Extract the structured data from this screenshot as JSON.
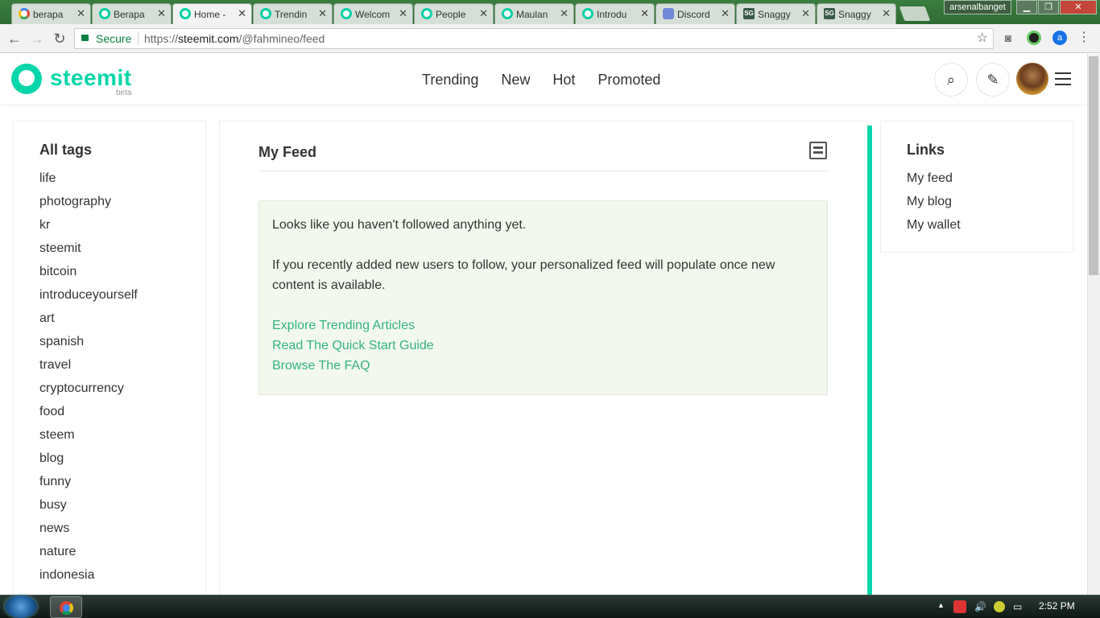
{
  "browser": {
    "tabs": [
      {
        "label": "berapa",
        "favicon": "google-icon"
      },
      {
        "label": "Berapa",
        "favicon": "steemit-icon"
      },
      {
        "label": "Home -",
        "favicon": "steemit-icon",
        "active": true
      },
      {
        "label": "Trendin",
        "favicon": "steemit-icon"
      },
      {
        "label": "Welcom",
        "favicon": "steemit-icon"
      },
      {
        "label": "People",
        "favicon": "steemit-icon"
      },
      {
        "label": "Maulan",
        "favicon": "steemit-icon"
      },
      {
        "label": "Introdu",
        "favicon": "steemit-icon"
      },
      {
        "label": "Discord",
        "favicon": "discord-icon"
      },
      {
        "label": "Snaggy",
        "favicon": "snaggy-icon"
      },
      {
        "label": "Snaggy",
        "favicon": "snaggy-icon"
      }
    ],
    "window_user": "arsenalbanget",
    "secure_label": "Secure",
    "url_scheme": "https://",
    "url_host": "steemit.com",
    "url_path": "/@fahmineo/feed",
    "snaggy_favicon_text": "SG"
  },
  "site": {
    "logo_text": "steemit",
    "logo_badge": "beta",
    "nav": [
      "Trending",
      "New",
      "Hot",
      "Promoted"
    ],
    "accent_color": "#06d6a9"
  },
  "left_sidebar": {
    "title": "All tags",
    "tags": [
      "life",
      "photography",
      "kr",
      "steemit",
      "bitcoin",
      "introduceyourself",
      "art",
      "spanish",
      "travel",
      "cryptocurrency",
      "food",
      "steem",
      "blog",
      "funny",
      "busy",
      "news",
      "nature",
      "indonesia"
    ]
  },
  "feed": {
    "title": "My Feed",
    "notice_line1": "Looks like you haven't followed anything yet.",
    "notice_line2": "If you recently added new users to follow, your personalized feed will populate once new content is available.",
    "links": [
      "Explore Trending Articles",
      "Read The Quick Start Guide",
      "Browse The FAQ"
    ]
  },
  "right_sidebar": {
    "title": "Links",
    "links": [
      "My feed",
      "My blog",
      "My wallet"
    ]
  },
  "taskbar": {
    "clock": "2:52 PM"
  }
}
